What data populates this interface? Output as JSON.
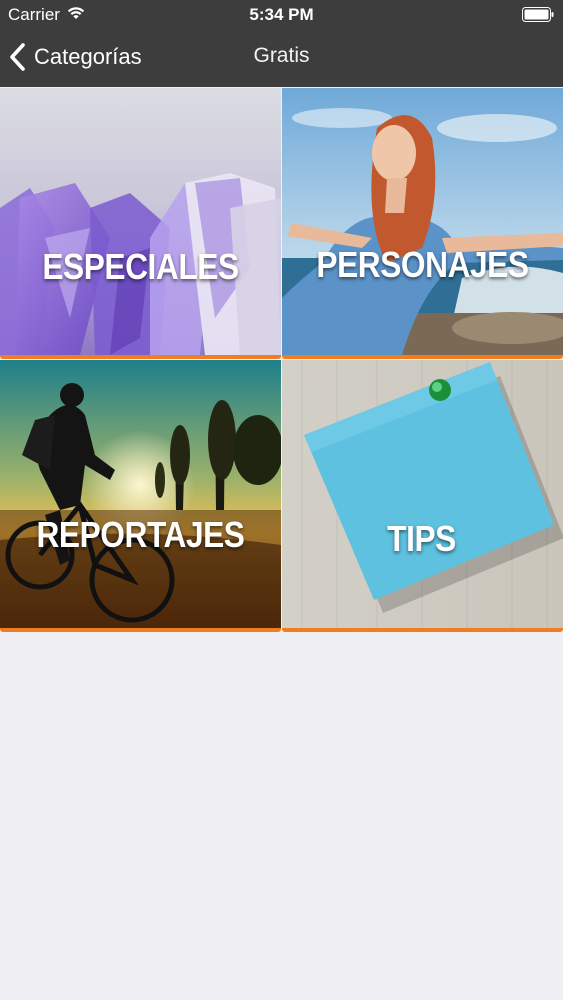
{
  "status_bar": {
    "carrier": "Carrier",
    "time": "5:34 PM",
    "wifi_icon": "wifi-icon",
    "battery_icon": "battery-icon"
  },
  "navbar": {
    "back_label": "Categorías",
    "back_icon": "chevron-left-icon",
    "title": "Gratis"
  },
  "categories": [
    {
      "label": "ESPECIALES",
      "image": "amethyst-crystals-photo"
    },
    {
      "label": "PERSONAJES",
      "image": "woman-arms-open-seaside-photo"
    },
    {
      "label": "REPORTAJES",
      "image": "cyclist-sunset-lake-photo"
    },
    {
      "label": "TIPS",
      "image": "blue-sticky-note-photo"
    }
  ],
  "colors": {
    "navbar_bg": "#3d3d3d",
    "tile_accent": "#f07d22",
    "page_bg": "#efeff4"
  }
}
